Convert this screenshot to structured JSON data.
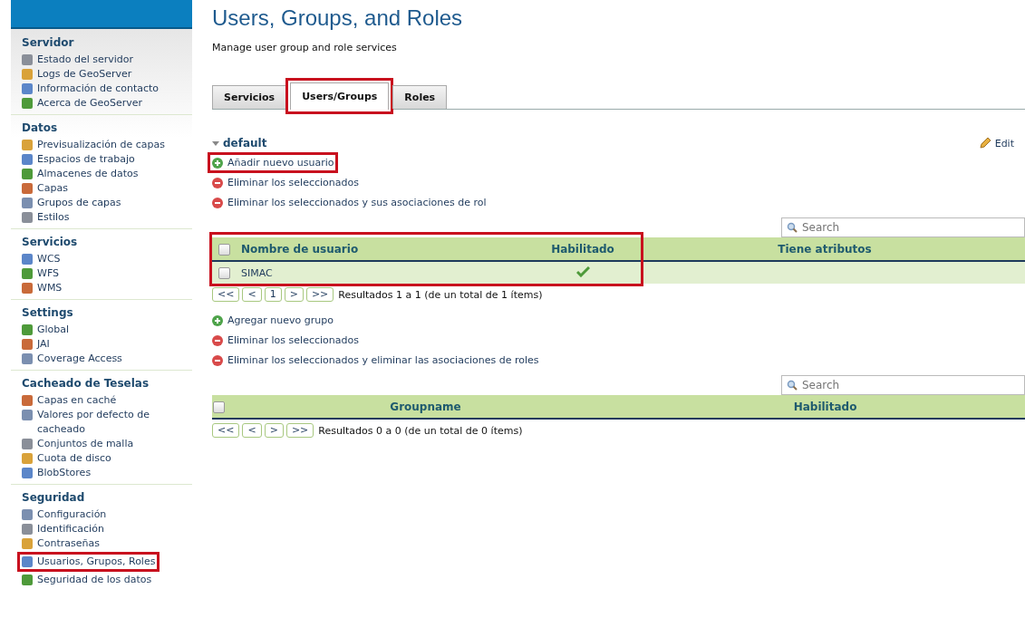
{
  "sidebar": {
    "sections": [
      {
        "title": "Servidor",
        "items": [
          {
            "label": "Estado del servidor",
            "highlighted": false
          },
          {
            "label": "Logs de GeoServer",
            "highlighted": false
          },
          {
            "label": "Información de contacto",
            "highlighted": false
          },
          {
            "label": "Acerca de GeoServer",
            "highlighted": false
          }
        ]
      },
      {
        "title": "Datos",
        "items": [
          {
            "label": "Previsualización de capas",
            "highlighted": false
          },
          {
            "label": "Espacios de trabajo",
            "highlighted": false
          },
          {
            "label": "Almacenes de datos",
            "highlighted": false
          },
          {
            "label": "Capas",
            "highlighted": false
          },
          {
            "label": "Grupos de capas",
            "highlighted": false
          },
          {
            "label": "Estilos",
            "highlighted": false
          }
        ]
      },
      {
        "title": "Servicios",
        "items": [
          {
            "label": "WCS",
            "highlighted": false
          },
          {
            "label": "WFS",
            "highlighted": false
          },
          {
            "label": "WMS",
            "highlighted": false
          }
        ]
      },
      {
        "title": "Settings",
        "items": [
          {
            "label": "Global",
            "highlighted": false
          },
          {
            "label": "JAI",
            "highlighted": false
          },
          {
            "label": "Coverage Access",
            "highlighted": false
          }
        ]
      },
      {
        "title": "Cacheado de Teselas",
        "items": [
          {
            "label": "Capas en caché",
            "highlighted": false
          },
          {
            "label": "Valores por defecto de cacheado",
            "highlighted": false
          },
          {
            "label": "Conjuntos de malla",
            "highlighted": false
          },
          {
            "label": "Cuota de disco",
            "highlighted": false
          },
          {
            "label": "BlobStores",
            "highlighted": false
          }
        ]
      },
      {
        "title": "Seguridad",
        "items": [
          {
            "label": "Configuración",
            "highlighted": false
          },
          {
            "label": "Identificación",
            "highlighted": false
          },
          {
            "label": "Contraseñas",
            "highlighted": false
          },
          {
            "label": "Usuarios, Grupos, Roles",
            "highlighted": true
          },
          {
            "label": "Seguridad de los datos",
            "highlighted": false
          }
        ]
      }
    ]
  },
  "page": {
    "title": "Users, Groups, and Roles",
    "subtitle": "Manage user group and role services"
  },
  "tabs": [
    {
      "label": "Servicios",
      "selected": false,
      "highlighted": false
    },
    {
      "label": "Users/Groups",
      "selected": true,
      "highlighted": true
    },
    {
      "label": "Roles",
      "selected": false,
      "highlighted": false
    }
  ],
  "service": {
    "name": "default",
    "expanded": true,
    "edit": "Edit"
  },
  "users": {
    "actions": [
      {
        "label": "Añadir nuevo usuario",
        "kind": "add",
        "highlighted": true
      },
      {
        "label": "Eliminar los seleccionados",
        "kind": "remove",
        "highlighted": false
      },
      {
        "label": "Eliminar los seleccionados y sus asociaciones de rol",
        "kind": "remove",
        "highlighted": false
      }
    ],
    "search": {
      "placeholder": "Search"
    },
    "select_all": false,
    "columns": [
      "Nombre de usuario",
      "Habilitado",
      "Tiene atributos"
    ],
    "rows": [
      {
        "name": "SIMAC",
        "enabled": true,
        "checked": false
      }
    ],
    "pager": [
      "<<",
      "<",
      "1",
      ">",
      ">>"
    ],
    "results": "Resultados 1 a 1 (de un total de 1 ítems)"
  },
  "groups": {
    "actions": [
      {
        "label": "Agregar nuevo grupo",
        "kind": "add",
        "highlighted": false
      },
      {
        "label": "Eliminar los seleccionados",
        "kind": "remove",
        "highlighted": false
      },
      {
        "label": "Eliminar los seleccionados y eliminar las asociaciones de roles",
        "kind": "remove",
        "highlighted": false
      }
    ],
    "search": {
      "placeholder": "Search"
    },
    "select_all": false,
    "columns": [
      "Groupname",
      "Habilitado"
    ],
    "pager": [
      "<<",
      "<",
      ">",
      ">>"
    ],
    "results": "Resultados 0 a 0 (de un total de 0 ítems)"
  }
}
